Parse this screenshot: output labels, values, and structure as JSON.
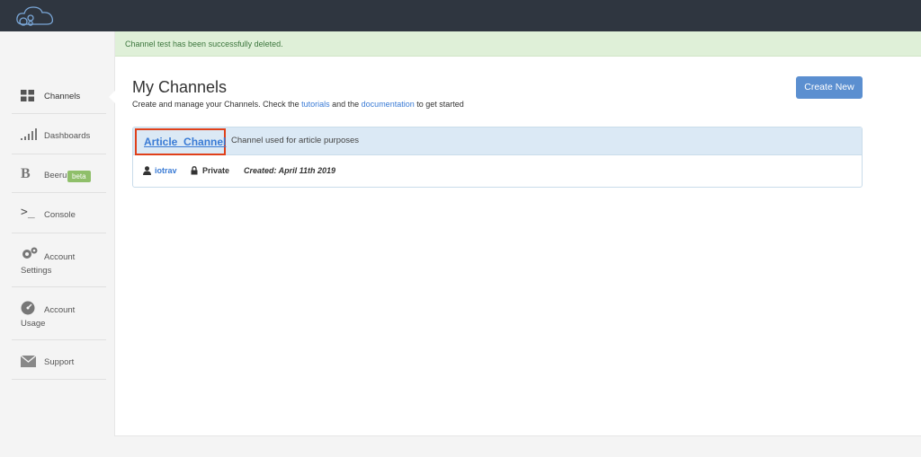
{
  "alert": {
    "message": "Channel test has been successfully deleted."
  },
  "sidebar": {
    "items": [
      {
        "label": "Channels",
        "icon": "grid-icon"
      },
      {
        "label": "Dashboards",
        "icon": "bar-chart-icon"
      },
      {
        "label": "Beerules",
        "icon": "beerules-b-icon",
        "badge": "beta"
      },
      {
        "label": "Console",
        "icon": "terminal-prompt-icon"
      },
      {
        "label": "Account Settings",
        "icon": "gears-icon"
      },
      {
        "label": "Account Usage",
        "icon": "gauge-icon"
      },
      {
        "label": "Support",
        "icon": "envelope-icon"
      }
    ]
  },
  "main": {
    "title": "My Channels",
    "subtitle_prefix": "Create and manage your Channels. Check the ",
    "tutorials_link": "tutorials",
    "subtitle_and": " and the ",
    "documentation_link": "documentation",
    "subtitle_suffix": " to get started",
    "create_button": "Create New"
  },
  "channel": {
    "name": "Article_Channel",
    "description": "Channel used for article purposes",
    "owner": "iotrav",
    "privacy": "Private",
    "created": "Created: April 11th 2019"
  },
  "colors": {
    "topbar": "#2f3640",
    "accent": "#5b8fd0",
    "highlight": "#e0401a"
  }
}
